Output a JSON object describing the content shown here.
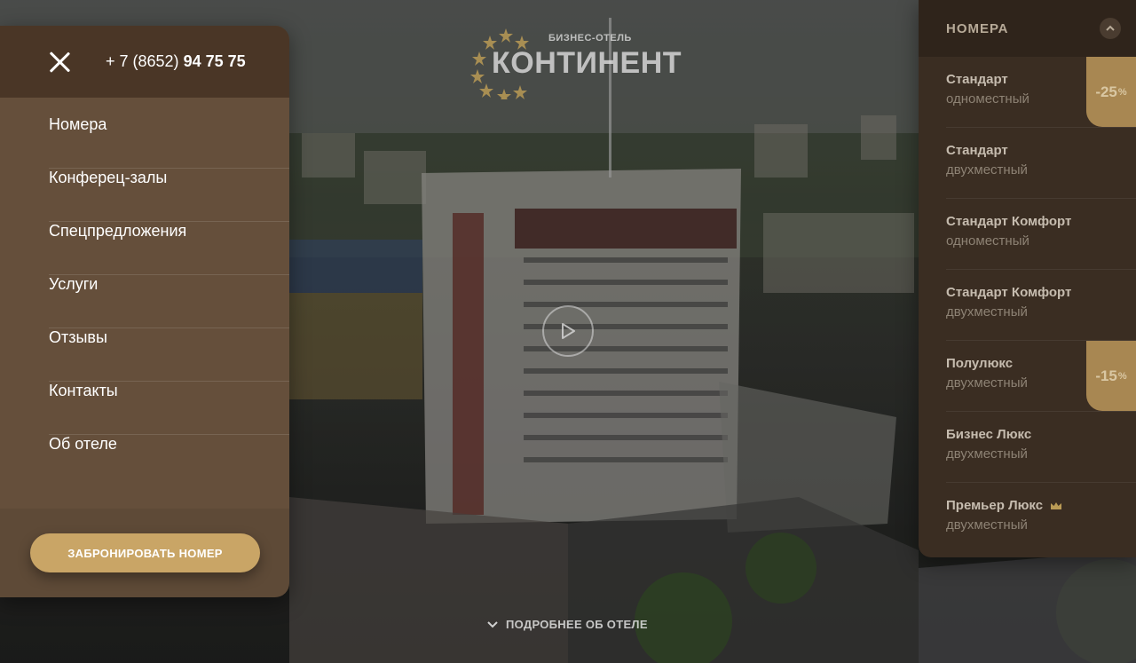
{
  "logo": {
    "subtitle": "БИЗНЕС-ОТЕЛЬ",
    "title": "КОНТИНЕНТ"
  },
  "menu": {
    "phone_prefix": "+ 7 (8652) ",
    "phone_number": "94 75 75",
    "items": [
      {
        "label": "Номера"
      },
      {
        "label": "Конферец-залы"
      },
      {
        "label": "Спецпредложения"
      },
      {
        "label": "Услуги"
      },
      {
        "label": "Отзывы"
      },
      {
        "label": "Контакты"
      },
      {
        "label": "Об отеле"
      }
    ],
    "book_label": "ЗАБРОНИРОВАТЬ НОМЕР"
  },
  "more_label": "ПОДРОБНЕЕ ОБ ОТЕЛЕ",
  "rooms": {
    "title": "НОМЕРА",
    "items": [
      {
        "name": "Стандарт",
        "type": "одноместный",
        "discount": "-25",
        "discount_unit": "%"
      },
      {
        "name": "Стандарт",
        "type": "двухместный"
      },
      {
        "name": "Стандарт Комфорт",
        "type": "одноместный"
      },
      {
        "name": "Стандарт Комфорт",
        "type": "двухместный"
      },
      {
        "name": "Полулюкс",
        "type": "двухместный",
        "discount": "-15",
        "discount_unit": "%"
      },
      {
        "name": "Бизнес Люкс",
        "type": "двухместный"
      },
      {
        "name": "Премьер Люкс",
        "type": "двухместный",
        "icon": "crown-icon"
      }
    ]
  },
  "colors": {
    "menu_bg": "#654f3b",
    "menu_head_bg": "#4a3626",
    "accent_gold": "#c9a566",
    "rooms_bg": "#3a2d22"
  }
}
